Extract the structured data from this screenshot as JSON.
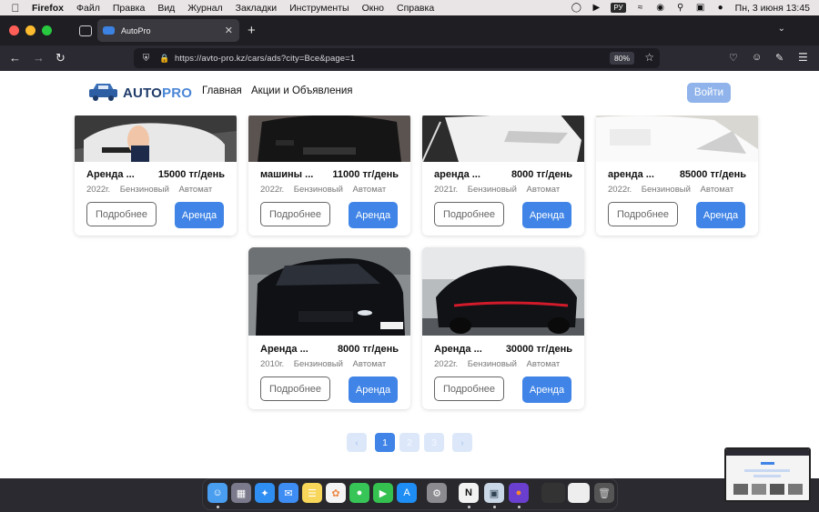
{
  "menubar": {
    "app": "Firefox",
    "items": [
      "Файл",
      "Правка",
      "Вид",
      "Журнал",
      "Закладки",
      "Инструменты",
      "Окно",
      "Справка"
    ],
    "lang": "РУ",
    "datetime": "Пн, 3 июня  13:45"
  },
  "browser": {
    "tab_title": "AutoPro",
    "url": "https://avto-pro.kz/cars/ads?city=Все&page=1",
    "zoom": "80%"
  },
  "site": {
    "logo_a": "AUTO",
    "logo_b": "PRO",
    "nav": [
      "Главная",
      "Акции и Объявления"
    ],
    "login": "Войти"
  },
  "cards": [
    {
      "name": "Аренда ...",
      "price": "15000 тг/день",
      "year": "2022г.",
      "fuel": "Бензиновый",
      "gear": "Автомат",
      "more": "Подробнее",
      "rent": "Аренда"
    },
    {
      "name": "машины ...",
      "price": "11000 тг/день",
      "year": "2022г.",
      "fuel": "Бензиновый",
      "gear": "Автомат",
      "more": "Подробнее",
      "rent": "Аренда"
    },
    {
      "name": "аренда ...",
      "price": "8000 тг/день",
      "year": "2021г.",
      "fuel": "Бензиновый",
      "gear": "Автомат",
      "more": "Подробнее",
      "rent": "Аренда"
    },
    {
      "name": "аренда ...",
      "price": "85000 тг/день",
      "year": "2022г.",
      "fuel": "Бензиновый",
      "gear": "Автомат",
      "more": "Подробнее",
      "rent": "Аренда"
    },
    {
      "name": "Аренда ...",
      "price": "8000 тг/день",
      "year": "2010г.",
      "fuel": "Бензиновый",
      "gear": "Автомат",
      "more": "Подробнее",
      "rent": "Аренда"
    },
    {
      "name": "Аренда ...",
      "price": "30000 тг/день",
      "year": "2022г.",
      "fuel": "Бензиновый",
      "gear": "Автомат",
      "more": "Подробнее",
      "rent": "Аренда"
    }
  ],
  "pagination": {
    "prev": "‹",
    "pages": [
      "1",
      "2",
      "3"
    ],
    "next": "›",
    "current": "1"
  },
  "colors": {
    "accent": "#3f84e6",
    "logo_dark": "#1f3b69"
  }
}
